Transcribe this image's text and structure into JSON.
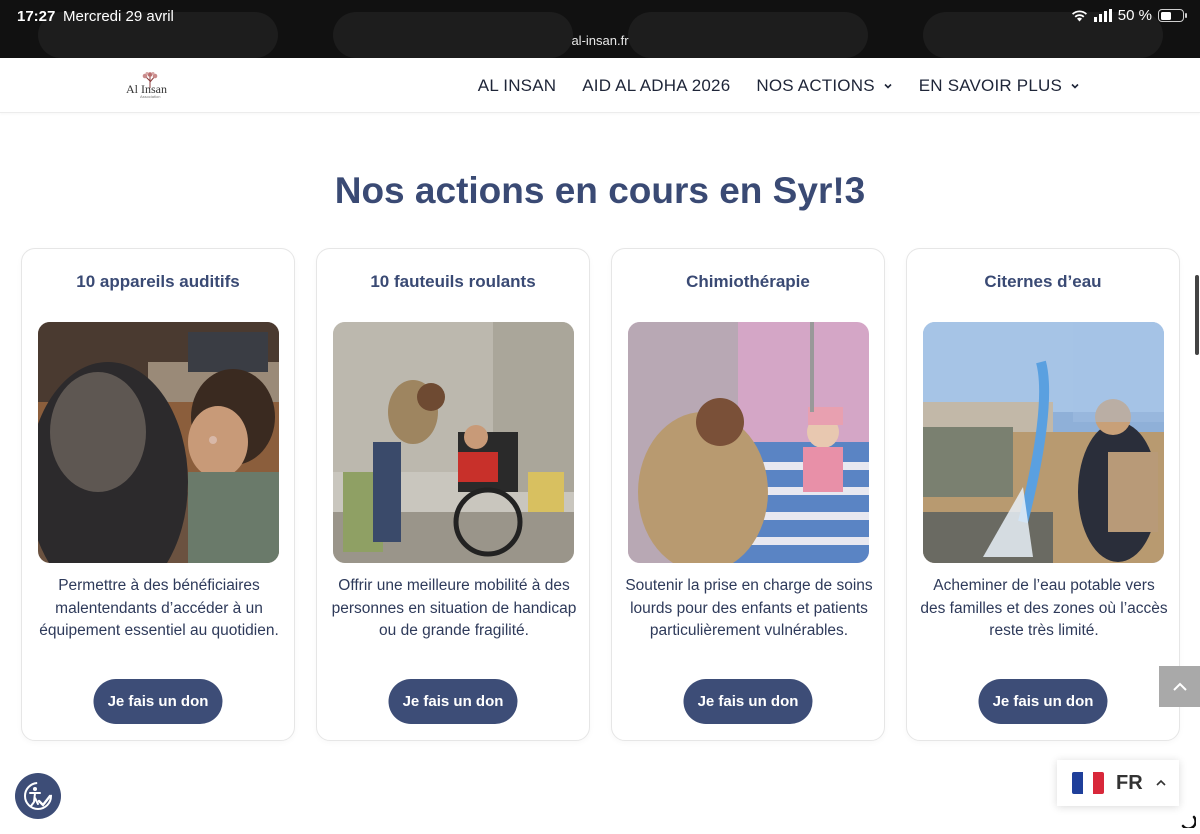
{
  "status_bar": {
    "time": "17:27",
    "date": "Mercredi 29 avril",
    "url": "al-insan.fr",
    "battery": "50 %",
    "battery_level": 0.5
  },
  "nav": {
    "logo_text": "Al Insan",
    "logo_sub": "Association",
    "items": [
      {
        "label": "AL INSAN",
        "dropdown": false
      },
      {
        "label": "AID AL ADHA 2026",
        "dropdown": false
      },
      {
        "label": "NOS ACTIONS",
        "dropdown": true
      },
      {
        "label": "EN SAVOIR PLUS",
        "dropdown": true
      }
    ]
  },
  "section": {
    "title": "Nos actions en cours en Syr!3"
  },
  "cards": [
    {
      "title": "10 appareils auditifs",
      "description": "Permettre à des bénéficiaires malentendants d’accéder à un équipement essentiel au quotidien.",
      "button": "Je fais un don",
      "photo": "hearing-aid-photo"
    },
    {
      "title": "10 fauteuils roulants",
      "description": "Offrir une meilleure mobilité à des personnes en situation de handicap ou de grande fragilité.",
      "button": "Je fais un don",
      "photo": "wheelchair-photo"
    },
    {
      "title": "Chimiothérapie",
      "description": "Soutenir la prise en charge de soins lourds pour des enfants et patients particulièrement vulnérables.",
      "button": "Je fais un don",
      "photo": "chemotherapy-photo"
    },
    {
      "title": "Citernes d’eau",
      "description": "Acheminer de l’eau potable vers des familles et des zones où l’accès reste très limité.",
      "button": "Je fais un don",
      "photo": "water-tank-photo"
    }
  ],
  "language": {
    "code": "FR",
    "flag": "french-flag"
  },
  "colors": {
    "brand": "#3d4d77",
    "title": "#3a4a74",
    "text": "#2e3a5a"
  }
}
